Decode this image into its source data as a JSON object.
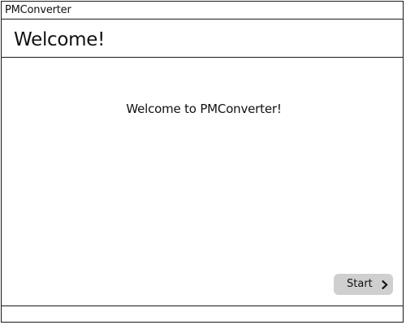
{
  "window": {
    "title": "PMConverter"
  },
  "header": {
    "title": "Welcome!"
  },
  "main": {
    "message": "Welcome to PMConverter!"
  },
  "actions": {
    "start_label": "Start",
    "start_icon": "chevron-right-icon",
    "start_button_color": "#cfcfcf"
  }
}
